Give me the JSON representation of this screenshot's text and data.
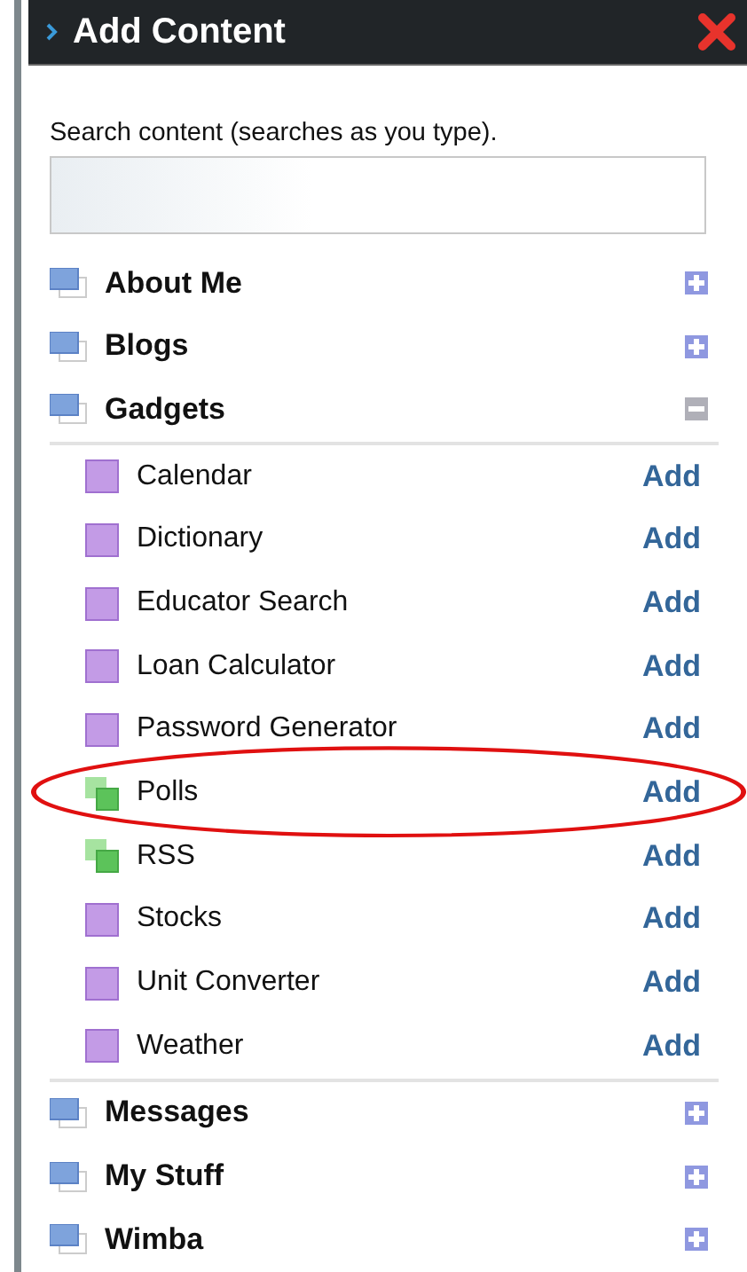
{
  "panel": {
    "title": "Add Content"
  },
  "search": {
    "label": "Search content (searches as you type)."
  },
  "categories": [
    {
      "name": "About Me",
      "expanded": false
    },
    {
      "name": "Blogs",
      "expanded": false
    },
    {
      "name": "Gadgets",
      "expanded": true,
      "children": [
        {
          "name": "Calendar",
          "kind": "gadget",
          "action": "Add",
          "highlighted": false
        },
        {
          "name": "Dictionary",
          "kind": "gadget",
          "action": "Add",
          "highlighted": false
        },
        {
          "name": "Educator Search",
          "kind": "gadget",
          "action": "Add",
          "highlighted": false
        },
        {
          "name": "Loan Calculator",
          "kind": "gadget",
          "action": "Add",
          "highlighted": false
        },
        {
          "name": "Password Generator",
          "kind": "gadget",
          "action": "Add",
          "highlighted": false
        },
        {
          "name": "Polls",
          "kind": "feed",
          "action": "Add",
          "highlighted": true
        },
        {
          "name": "RSS",
          "kind": "feed",
          "action": "Add",
          "highlighted": false
        },
        {
          "name": "Stocks",
          "kind": "gadget",
          "action": "Add",
          "highlighted": false
        },
        {
          "name": "Unit Converter",
          "kind": "gadget",
          "action": "Add",
          "highlighted": false
        },
        {
          "name": "Weather",
          "kind": "gadget",
          "action": "Add",
          "highlighted": false
        }
      ]
    },
    {
      "name": "Messages",
      "expanded": false
    },
    {
      "name": "My Stuff",
      "expanded": false
    },
    {
      "name": "Wimba",
      "expanded": false
    }
  ]
}
